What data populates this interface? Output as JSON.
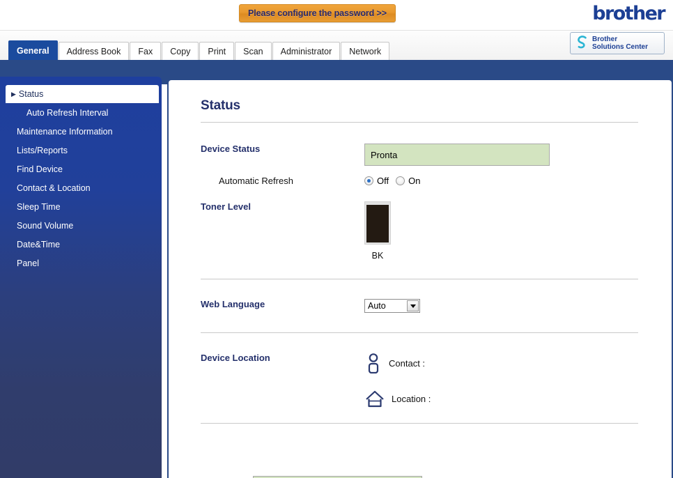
{
  "header": {
    "password_banner": "Please configure the password >>",
    "brand": "brother",
    "solutions_center_line1": "Brother",
    "solutions_center_line2": "Solutions Center"
  },
  "tabs": [
    {
      "label": "General",
      "active": true
    },
    {
      "label": "Address Book",
      "active": false
    },
    {
      "label": "Fax",
      "active": false
    },
    {
      "label": "Copy",
      "active": false
    },
    {
      "label": "Print",
      "active": false
    },
    {
      "label": "Scan",
      "active": false
    },
    {
      "label": "Administrator",
      "active": false
    },
    {
      "label": "Network",
      "active": false
    }
  ],
  "sidebar": {
    "items": [
      {
        "label": "Status",
        "active": true,
        "sub": false
      },
      {
        "label": "Auto Refresh Interval",
        "active": false,
        "sub": true
      },
      {
        "label": "Maintenance Information",
        "active": false,
        "sub": false
      },
      {
        "label": "Lists/Reports",
        "active": false,
        "sub": false
      },
      {
        "label": "Find Device",
        "active": false,
        "sub": false
      },
      {
        "label": "Contact & Location",
        "active": false,
        "sub": false
      },
      {
        "label": "Sleep Time",
        "active": false,
        "sub": false
      },
      {
        "label": "Sound Volume",
        "active": false,
        "sub": false
      },
      {
        "label": "Date&Time",
        "active": false,
        "sub": false
      },
      {
        "label": "Panel",
        "active": false,
        "sub": false
      }
    ]
  },
  "main": {
    "title": "Status",
    "device_status": {
      "label": "Device Status",
      "value": "Pronta"
    },
    "automatic_refresh": {
      "label": "Automatic Refresh",
      "options": [
        {
          "label": "Off",
          "selected": true
        },
        {
          "label": "On",
          "selected": false
        }
      ]
    },
    "toner": {
      "label": "Toner Level",
      "cartridges": [
        {
          "name": "BK",
          "level_percent": 96,
          "color": "#231a12"
        }
      ]
    },
    "web_language": {
      "label": "Web Language",
      "value": "Auto"
    },
    "device_location": {
      "label": "Device Location",
      "contact_label": "Contact :",
      "location_label": "Location :"
    }
  },
  "colors": {
    "navy": "#2a4a87",
    "tab_active": "#1b4b9e",
    "heading": "#24306b",
    "banner_orange": "#e8992e",
    "status_green": "#d3e4c0",
    "brand_blue": "#1c3f94",
    "swoosh_cyan": "#2bb5d4"
  }
}
